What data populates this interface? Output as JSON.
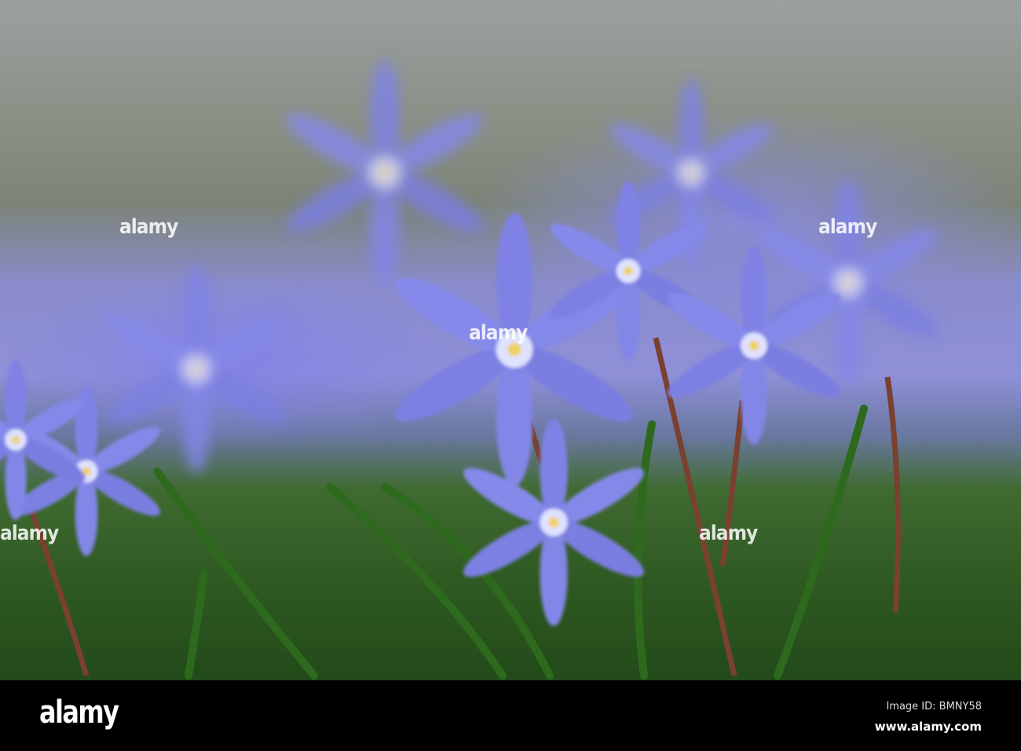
{
  "photo": {
    "subject": "blue glory-of-the-snow flowers",
    "colors": {
      "petal": "#7a7ee0",
      "grass": "#2f5a22",
      "stamen": "#f0d060"
    }
  },
  "watermark": {
    "text": "alamy"
  },
  "footer": {
    "logo": "alamy",
    "image_id": "Image ID: BMNY58",
    "site": "www.alamy.com"
  }
}
